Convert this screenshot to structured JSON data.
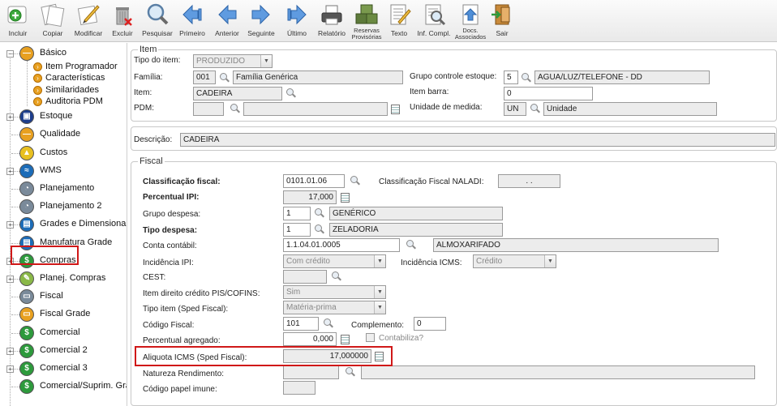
{
  "toolbar": {
    "buttons": [
      {
        "label": "Incluir",
        "icon": "add-icon"
      },
      {
        "label": "Copiar",
        "icon": "copy-icon"
      },
      {
        "label": "Modificar",
        "icon": "edit-icon"
      },
      {
        "label": "Excluir",
        "icon": "trash-icon"
      },
      {
        "label": "Pesquisar",
        "icon": "search-icon"
      },
      {
        "label": "Primeiro",
        "icon": "first-icon"
      },
      {
        "label": "Anterior",
        "icon": "previous-icon"
      },
      {
        "label": "Seguinte",
        "icon": "next-icon"
      },
      {
        "label": "Último",
        "icon": "last-icon"
      },
      {
        "label": "Relatório",
        "icon": "printer-icon"
      },
      {
        "label": "Reservas\nProvisórias",
        "icon": "reservations-icon"
      },
      {
        "label": "Texto",
        "icon": "text-icon"
      },
      {
        "label": "Inf. Compl.",
        "icon": "info-icon"
      },
      {
        "label": "Docs.\nAssociados",
        "icon": "documents-icon"
      },
      {
        "label": "Sair",
        "icon": "exit-icon"
      }
    ]
  },
  "sidebar": {
    "items": [
      {
        "label": "Básico",
        "icon": "basic-icon",
        "expander": "−",
        "color": "#e8a020",
        "glyph": "—"
      },
      {
        "label": "Estoque",
        "icon": "stock-icon",
        "expander": "+",
        "color": "#1c3d8c",
        "glyph": "▣"
      },
      {
        "label": "Qualidade",
        "icon": "quality-icon",
        "expander": "",
        "color": "#e8a020",
        "glyph": "—"
      },
      {
        "label": "Custos",
        "icon": "costs-icon",
        "expander": "",
        "color": "#e8c020",
        "glyph": "▲"
      },
      {
        "label": "WMS",
        "icon": "wms-icon",
        "expander": "+",
        "color": "#1c6cb8",
        "glyph": "≈"
      },
      {
        "label": "Planejamento",
        "icon": "planning-icon",
        "expander": "",
        "color": "#7a8a9a",
        "glyph": "◔"
      },
      {
        "label": "Planejamento 2",
        "icon": "planning2-icon",
        "expander": "",
        "color": "#7a8a9a",
        "glyph": "◔"
      },
      {
        "label": "Grades e Dimensionais",
        "icon": "grids-icon",
        "expander": "+",
        "color": "#1c6cb8",
        "glyph": "▤"
      },
      {
        "label": "Manufatura Grade",
        "icon": "manufacturing-icon",
        "expander": "",
        "color": "#1c6cb8",
        "glyph": "▤"
      },
      {
        "label": "Compras",
        "icon": "purchases-icon",
        "expander": "+",
        "color": "#2d9a3c",
        "glyph": "$"
      },
      {
        "label": "Planej. Compras",
        "icon": "purchase-planning-icon",
        "expander": "+",
        "color": "#8ab848",
        "glyph": "✎"
      },
      {
        "label": "Fiscal",
        "icon": "fiscal-icon",
        "expander": "",
        "color": "#7a8a9a",
        "glyph": "▭"
      },
      {
        "label": "Fiscal Grade",
        "icon": "fiscal-grid-icon",
        "expander": "",
        "color": "#e8a020",
        "glyph": "▭"
      },
      {
        "label": "Comercial",
        "icon": "commercial-icon",
        "expander": "",
        "color": "#2d9a3c",
        "glyph": "$"
      },
      {
        "label": "Comercial 2",
        "icon": "commercial2-icon",
        "expander": "+",
        "color": "#2d9a3c",
        "glyph": "$"
      },
      {
        "label": "Comercial 3",
        "icon": "commercial3-icon",
        "expander": "+",
        "color": "#2d9a3c",
        "glyph": "$"
      },
      {
        "label": "Comercial/Suprim. Grade",
        "icon": "commercial-supply-icon",
        "expander": "",
        "color": "#2d9a3c",
        "glyph": "$"
      }
    ],
    "sub_items": [
      {
        "label": "Item Programador"
      },
      {
        "label": "Características"
      },
      {
        "label": "Similaridades"
      },
      {
        "label": "Auditoria PDM"
      }
    ],
    "selected": "Fiscal"
  },
  "item_group": {
    "legend": "Item",
    "tipo_item_label": "Tipo do item:",
    "tipo_item_value": "PRODUZIDO",
    "familia_label": "Família:",
    "familia_code": "001",
    "familia_desc": "Família Genérica",
    "grupo_label": "Grupo controle estoque:",
    "grupo_code": "5",
    "grupo_desc": "AGUA/LUZ/TELEFONE - DD",
    "item_label": "Item:",
    "item_value": "CADEIRA",
    "item_barra_label": "Item barra:",
    "item_barra_value": "0",
    "pdm_label": "PDM:",
    "unidade_label": "Unidade de medida:",
    "unidade_code": "UN",
    "unidade_desc": "Unidade"
  },
  "descricao": {
    "label": "Descrição:",
    "value": "CADEIRA"
  },
  "fiscal_group": {
    "legend": "Fiscal",
    "classificacao_label": "Classificação fiscal:",
    "classificacao_value": "0101.01.06",
    "naladi_label": "Classificação Fiscal NALADI:",
    "naladi_value": ". .",
    "ipi_label": "Percentual IPI:",
    "ipi_value": "17,000",
    "grupo_despesa_label": "Grupo despesa:",
    "grupo_despesa_code": "1",
    "grupo_despesa_desc": "GENÉRICO",
    "tipo_despesa_label": "Tipo despesa:",
    "tipo_despesa_code": "1",
    "tipo_despesa_desc": "ZELADORIA",
    "conta_label": "Conta contábil:",
    "conta_code": "1.1.04.01.0005",
    "conta_desc": "ALMOXARIFADO",
    "incid_ipi_label": "Incidência IPI:",
    "incid_ipi_value": "Com crédito",
    "incid_icms_label": "Incidência ICMS:",
    "incid_icms_value": "Crédito",
    "cest_label": "CEST:",
    "pis_label": "Item direito crédito PIS/COFINS:",
    "pis_value": "Sim",
    "tipo_sped_label": "Tipo item (Sped Fiscal):",
    "tipo_sped_value": "Matéria-prima",
    "codigo_fiscal_label": "Código Fiscal:",
    "codigo_fiscal_value": "101",
    "complemento_label": "Complemento:",
    "complemento_value": "0",
    "perc_agregado_label": "Percentual agregado:",
    "perc_agregado_value": "0,000",
    "contabiliza_label": "Contabiliza?",
    "aliquota_label": "Aliquota ICMS (Sped Fiscal):",
    "aliquota_value": "17,000000",
    "natureza_label": "Natureza Rendimento:",
    "papel_label": "Código papel imune:"
  },
  "colors": {
    "highlight": "#d01818",
    "toolbar_arrow": "#4f8fd8"
  }
}
